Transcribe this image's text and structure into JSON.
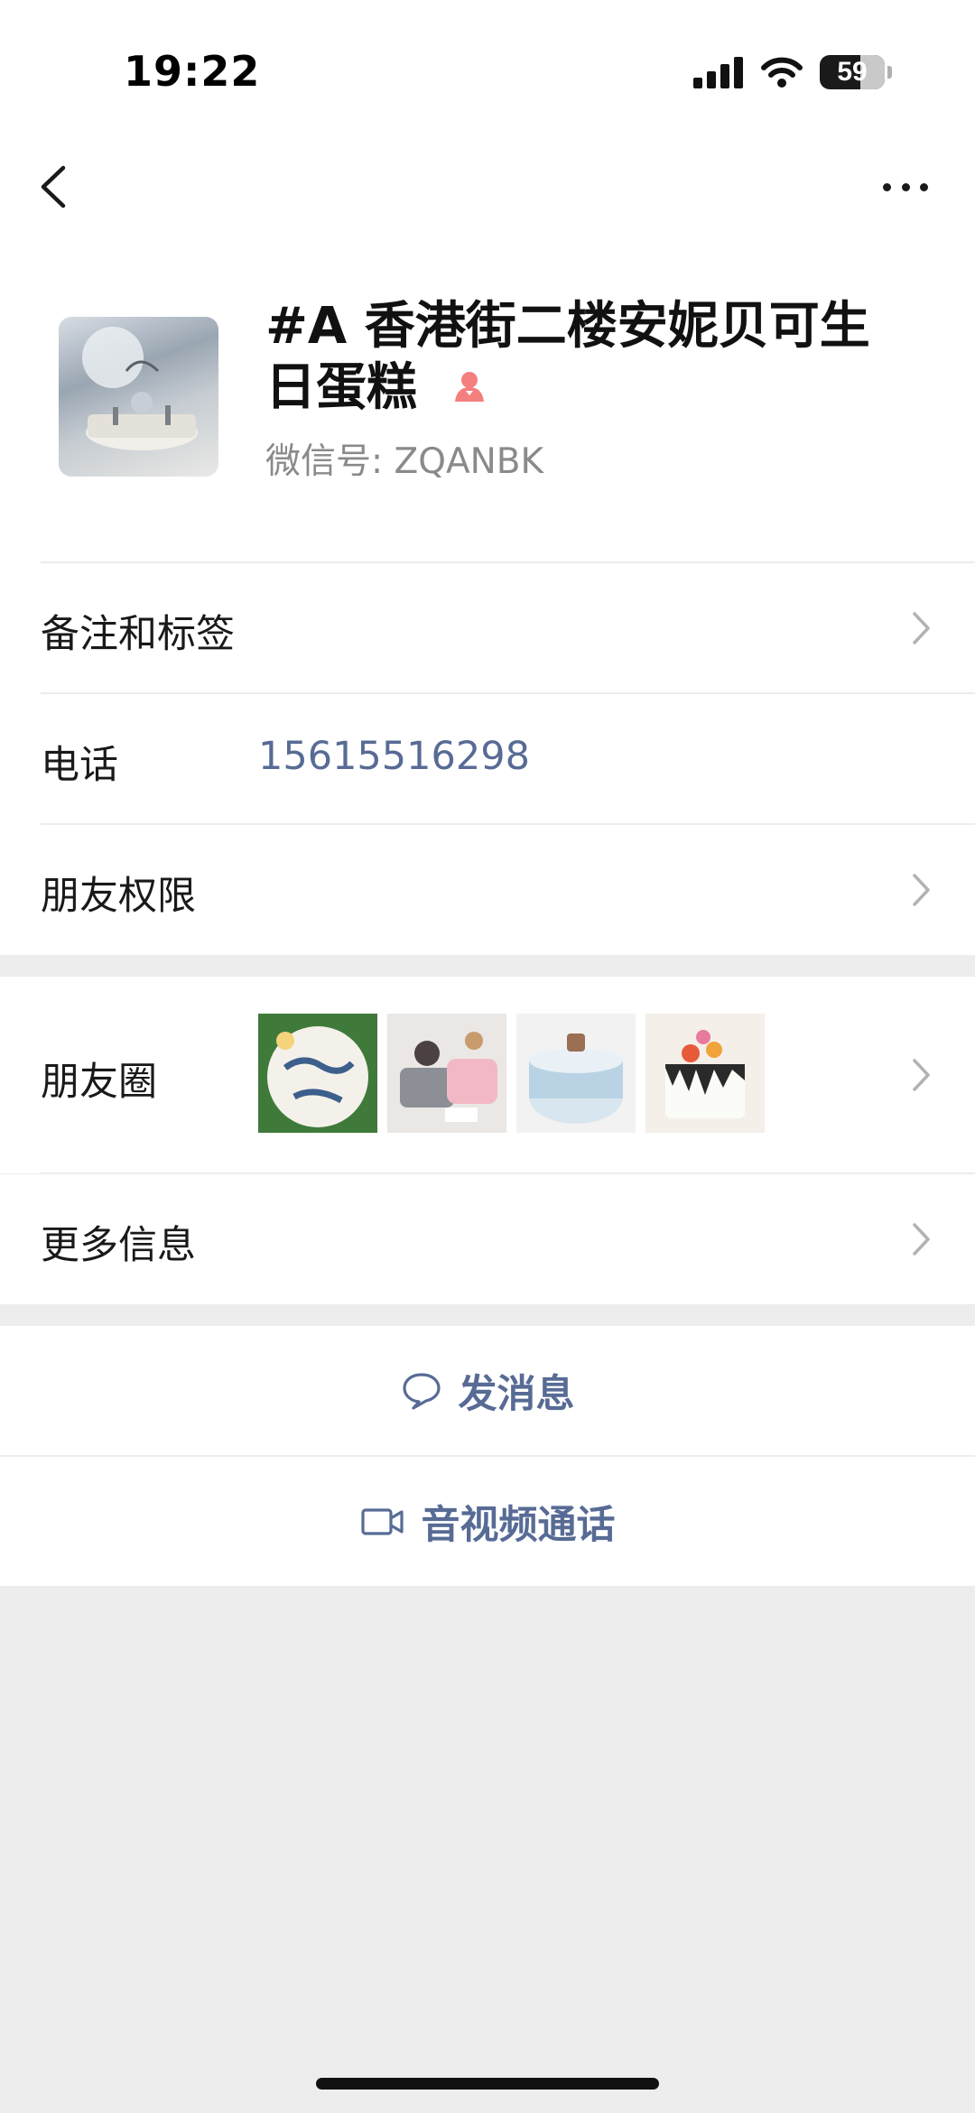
{
  "status": {
    "time": "19:22",
    "battery": "59"
  },
  "contact": {
    "name": "#A 香港街二楼安妮贝可生日蛋糕",
    "wechat_id_label": "微信号: ZQANBK"
  },
  "rows": {
    "remarks_tags": "备注和标签",
    "phone_label": "电话",
    "phone_value": "15615516298",
    "friend_permissions": "朋友权限",
    "moments": "朋友圈",
    "more_info": "更多信息"
  },
  "actions": {
    "send_message": "发消息",
    "video_call": "音视频通话"
  },
  "colors": {
    "link": "#576b95",
    "background": "#ededed",
    "gender_female": "#f47f7f"
  },
  "icons": [
    "back-icon",
    "more-icon",
    "female-icon",
    "chevron-right-icon",
    "message-bubble-icon",
    "video-camera-icon"
  ]
}
